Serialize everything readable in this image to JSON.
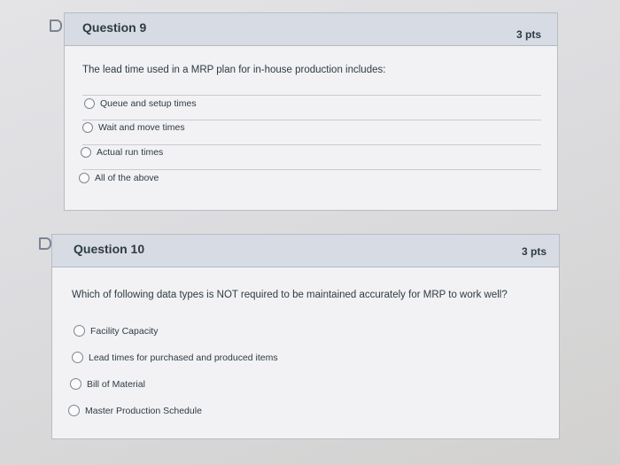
{
  "questions": [
    {
      "title": "Question 9",
      "points": "3 pts",
      "prompt": "The lead time used in a MRP plan for in-house production includes:",
      "options": [
        "Queue and setup times",
        "Wait and move times",
        "Actual run times",
        "All of the above"
      ]
    },
    {
      "title": "Question 10",
      "points": "3 pts",
      "prompt": "Which of following data types is NOT required to be maintained accurately for MRP to work well?",
      "options": [
        "Facility Capacity",
        "Lead times for purchased and produced items",
        "Bill of Material",
        "Master Production Schedule"
      ]
    }
  ]
}
